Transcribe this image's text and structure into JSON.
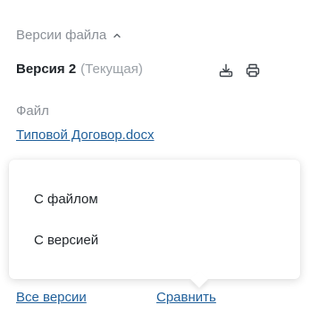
{
  "section": {
    "title": "Версии файла",
    "toggle_icon": "chevron-up-icon"
  },
  "version": {
    "title": "Версия 2",
    "status": "(Текущая)",
    "actions": [
      {
        "icon": "download-icon"
      },
      {
        "icon": "print-icon"
      }
    ]
  },
  "file": {
    "label": "Файл",
    "name": "Типовой Договор.docx"
  },
  "compare_menu": {
    "items": [
      "С файлом",
      "С версией"
    ]
  },
  "footer": {
    "all_versions": "Все версии",
    "compare": "Сравнить"
  },
  "colors": {
    "link": "#1f5f9a",
    "muted": "#8a8f96",
    "text": "#1f2429"
  }
}
